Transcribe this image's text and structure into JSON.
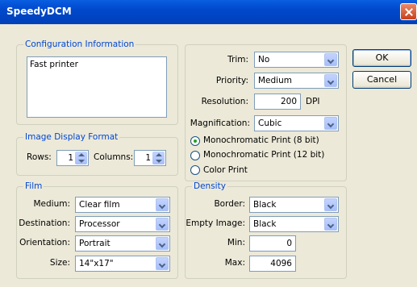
{
  "window": {
    "title": "SpeedyDCM"
  },
  "config": {
    "legend": "Configuration Information",
    "printer_name": "Fast printer"
  },
  "image_display": {
    "legend": "Image Display Format",
    "rows_label": "Rows:",
    "rows_value": "1",
    "columns_label": "Columns:",
    "columns_value": "1"
  },
  "film": {
    "legend": "Film",
    "medium_label": "Medium:",
    "medium_value": "Clear film",
    "destination_label": "Destination:",
    "destination_value": "Processor",
    "orientation_label": "Orientation:",
    "orientation_value": "Portrait",
    "size_label": "Size:",
    "size_value": "14\"x17\""
  },
  "print": {
    "trim_label": "Trim:",
    "trim_value": "No",
    "priority_label": "Priority:",
    "priority_value": "Medium",
    "resolution_label": "Resolution:",
    "resolution_value": "200",
    "resolution_unit": "DPI",
    "magnification_label": "Magnification:",
    "magnification_value": "Cubic",
    "color_modes": [
      {
        "label": "Monochromatic Print (8 bit)",
        "checked": true
      },
      {
        "label": "Monochromatic Print (12 bit)",
        "checked": false
      },
      {
        "label": "Color Print",
        "checked": false
      }
    ]
  },
  "density": {
    "legend": "Density",
    "border_label": "Border:",
    "border_value": "Black",
    "empty_image_label": "Empty Image:",
    "empty_image_value": "Black",
    "min_label": "Min:",
    "min_value": "0",
    "max_label": "Max:",
    "max_value": "4096"
  },
  "buttons": {
    "ok": "OK",
    "cancel": "Cancel"
  }
}
